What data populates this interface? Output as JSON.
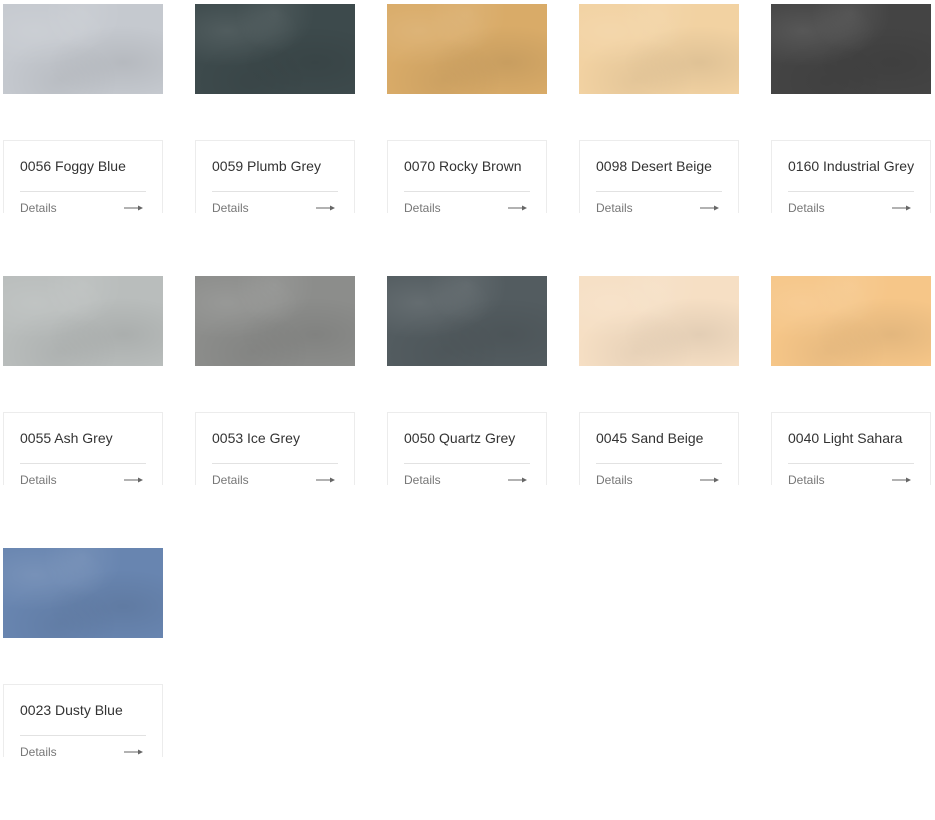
{
  "products": [
    {
      "name": "0056 Foggy Blue",
      "details_label": "Details",
      "swatch_color": "#c5c9cf"
    },
    {
      "name": "0059 Plumb Grey",
      "details_label": "Details",
      "swatch_color": "#3d4a4c"
    },
    {
      "name": "0070 Rocky Brown",
      "details_label": "Details",
      "swatch_color": "#d9ab68"
    },
    {
      "name": "0098 Desert Beige",
      "details_label": "Details",
      "swatch_color": "#f2d2a2"
    },
    {
      "name": "0160 Industrial Grey",
      "details_label": "Details",
      "swatch_color": "#444444"
    },
    {
      "name": "0055 Ash Grey",
      "details_label": "Details",
      "swatch_color": "#b9bdbc"
    },
    {
      "name": "0053 Ice Grey",
      "details_label": "Details",
      "swatch_color": "#8c8d8b"
    },
    {
      "name": "0050 Quartz Grey",
      "details_label": "Details",
      "swatch_color": "#535c60"
    },
    {
      "name": "0045 Sand Beige",
      "details_label": "Details",
      "swatch_color": "#f6dfc4"
    },
    {
      "name": "0040 Light Sahara",
      "details_label": "Details",
      "swatch_color": "#f6c688"
    },
    {
      "name": "0023 Dusty Blue",
      "details_label": "Details",
      "swatch_color": "#6885b0"
    }
  ]
}
